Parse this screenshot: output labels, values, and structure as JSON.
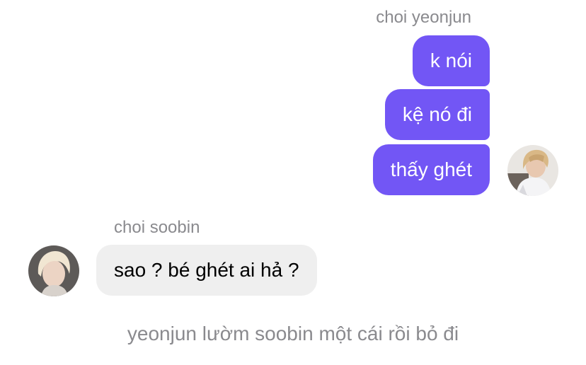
{
  "outgoing": {
    "sender_name": "choi yeonjun",
    "messages": [
      "k nói",
      "kệ nó đi",
      "thấy ghét"
    ],
    "avatar_icon": "person-photo-icon",
    "bubble_color": "#7256f5"
  },
  "incoming": {
    "sender_name": "choi soobin",
    "messages": [
      "sao ? bé ghét ai hả ?"
    ],
    "avatar_icon": "person-photo-icon",
    "bubble_color": "#efefef"
  },
  "narration": "yeonjun lườm soobin một cái rồi bỏ đi"
}
